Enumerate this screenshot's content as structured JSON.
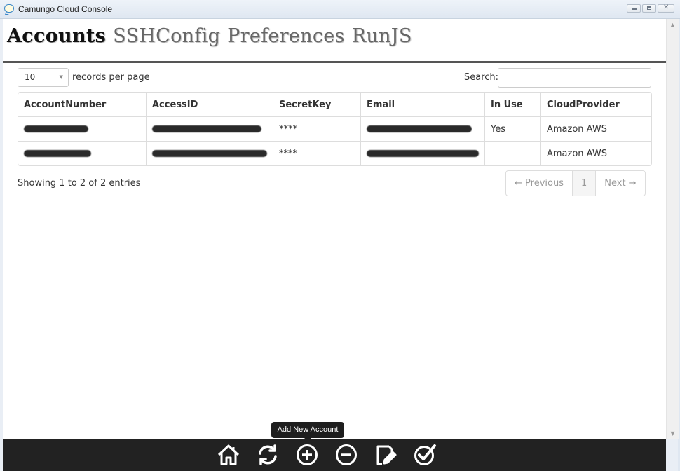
{
  "window": {
    "title": "Camungo Cloud Console"
  },
  "header": {
    "tabs": [
      {
        "label": "Accounts",
        "active": true
      },
      {
        "label": "SSHConfig",
        "active": false
      },
      {
        "label": "Preferences",
        "active": false
      },
      {
        "label": "RunJS",
        "active": false
      }
    ]
  },
  "controls": {
    "length_value": "10",
    "length_label": "records per page",
    "search_label": "Search:",
    "search_value": ""
  },
  "table": {
    "columns": [
      "AccountNumber",
      "AccessID",
      "SecretKey",
      "Email",
      "In Use",
      "CloudProvider"
    ],
    "rows": [
      {
        "account_number": "[redacted]",
        "access_id": "[redacted]",
        "secret_key": "****",
        "email": "[redacted]",
        "in_use": "Yes",
        "cloud_provider": "Amazon AWS"
      },
      {
        "account_number": "[redacted]",
        "access_id": "[redacted]",
        "secret_key": "****",
        "email": "[redacted]",
        "in_use": "",
        "cloud_provider": "Amazon AWS"
      }
    ]
  },
  "info": {
    "text": "Showing 1 to 2 of 2 entries"
  },
  "pagination": {
    "previous": "← Previous",
    "current": "1",
    "next": "Next →"
  },
  "toolbar": {
    "tooltip": "Add New Account",
    "icons": [
      "home-icon",
      "refresh-icon",
      "add-icon",
      "remove-icon",
      "edit-icon",
      "check-icon"
    ]
  }
}
